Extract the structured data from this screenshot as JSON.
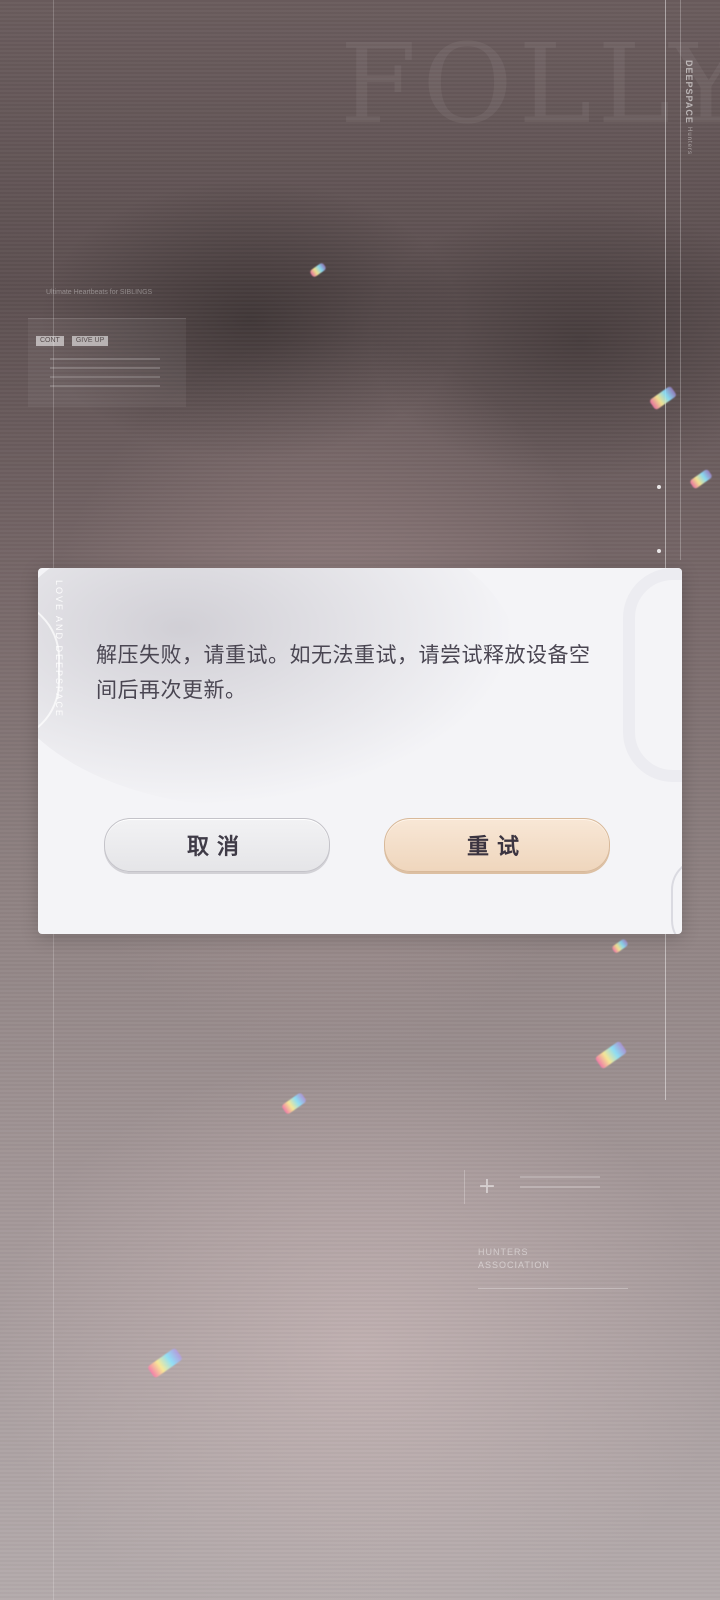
{
  "background": {
    "big_letters": "FOLLY",
    "brand": "DEEPSPACE",
    "brand_sub": "Hunters",
    "hud_caption": "Ultimate Heartbeats for SIBLINGS",
    "hud_tags": [
      "CONT",
      "GIVE UP"
    ],
    "association": [
      "HUNTERS",
      "ASSOCIATION"
    ],
    "plus_symbol": "+"
  },
  "dialog": {
    "side_text": "LOVE AND DEEPSPACE",
    "message": "解压失败，请重试。如无法重试，请尝试释放设备空间后再次更新。",
    "cancel_label": "取消",
    "retry_label": "重试"
  },
  "colors": {
    "dialog_bg": "#f4f4f7",
    "message_text": "#4a4652",
    "retry_button": "#f2dcc5",
    "cancel_button": "#ececee"
  }
}
